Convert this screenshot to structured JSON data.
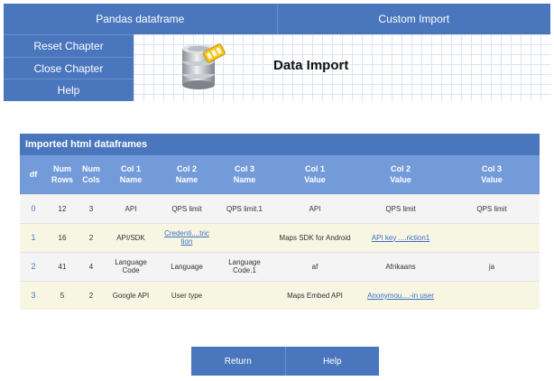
{
  "top_tabs": {
    "pandas_dataframe": "Pandas dataframe",
    "custom_import": "Custom Import"
  },
  "sidebar": {
    "reset_chapter": "Reset Chapter",
    "close_chapter": "Close Chapter",
    "help": "Help"
  },
  "banner": {
    "title": "Data Import",
    "icon": "database-icon"
  },
  "table": {
    "caption": "Imported html dataframes",
    "headers": [
      [
        "df",
        ""
      ],
      [
        "Num",
        "Rows"
      ],
      [
        "Num",
        "Cols"
      ],
      [
        "Col 1",
        "Name"
      ],
      [
        "Col 2",
        "Name"
      ],
      [
        "Col 3",
        "Name"
      ],
      [
        "Col 1",
        "Value"
      ],
      [
        "Col 2",
        "Value"
      ],
      [
        "Col 3",
        "Value"
      ]
    ],
    "rows": [
      {
        "df": "0",
        "rows": "12",
        "cols": "3",
        "c1name": "API",
        "c2name": "QPS limit",
        "c3name": "QPS limit.1",
        "c1val": "API",
        "c2val": "QPS limit",
        "c3val": "QPS limit"
      },
      {
        "df": "1",
        "rows": "16",
        "cols": "2",
        "c1name": "API/SDK",
        "c2name": "Credenti....tric tion",
        "c3name": "",
        "c1val": "Maps SDK for Android",
        "c2val": "API key ....riction1",
        "c3val": ""
      },
      {
        "df": "2",
        "rows": "41",
        "cols": "4",
        "c1name": "Language Code",
        "c2name": "Language",
        "c3name": "Language Code.1",
        "c1val": "af",
        "c2val": "Afrikaans",
        "c3val": "ja"
      },
      {
        "df": "3",
        "rows": "5",
        "cols": "2",
        "c1name": "Google API",
        "c2name": "User type",
        "c3name": "",
        "c1val": "Maps Embed API",
        "c2val": "Anonymou....-in user",
        "c3val": ""
      }
    ]
  },
  "bottom": {
    "return": "Return",
    "help": "Help"
  },
  "colors": {
    "primary": "#4a76bd",
    "header": "#739bd9",
    "link": "#3e6fc4"
  }
}
